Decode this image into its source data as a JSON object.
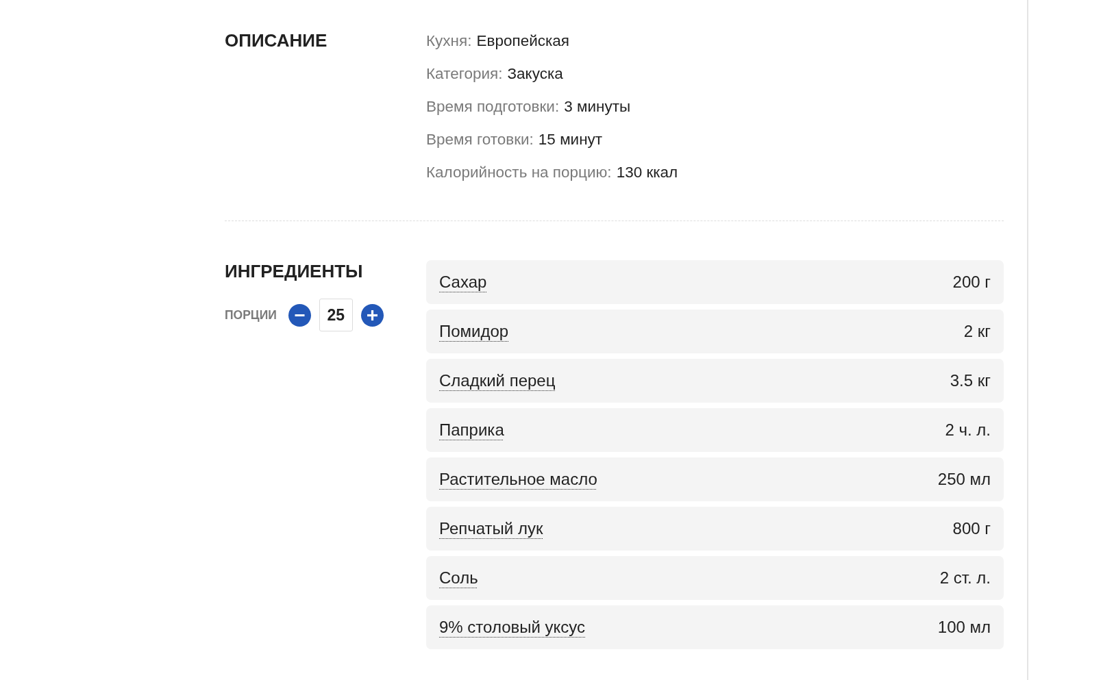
{
  "description": {
    "heading": "ОПИСАНИЕ",
    "items": [
      {
        "label": "Кухня:",
        "value": "Европейская"
      },
      {
        "label": "Категория:",
        "value": "Закуска"
      },
      {
        "label": "Время подготовки:",
        "value": "3 минуты"
      },
      {
        "label": "Время готовки:",
        "value": "15 минут"
      },
      {
        "label": "Калорийность на порцию:",
        "value": "130 ккал"
      }
    ]
  },
  "ingredients": {
    "heading": "ИНГРЕДИЕНТЫ",
    "servings": {
      "label": "ПОРЦИИ",
      "value": "25"
    },
    "items": [
      {
        "name": "Сахар",
        "amount": "200 г"
      },
      {
        "name": "Помидор",
        "amount": "2 кг"
      },
      {
        "name": "Сладкий перец",
        "amount": "3.5 кг"
      },
      {
        "name": "Паприка",
        "amount": "2 ч. л."
      },
      {
        "name": "Растительное масло",
        "amount": "250 мл"
      },
      {
        "name": "Репчатый лук",
        "amount": "800 г"
      },
      {
        "name": "Соль",
        "amount": "2 ст. л."
      },
      {
        "name": "9% столовый уксус",
        "amount": "100 мл"
      }
    ]
  }
}
